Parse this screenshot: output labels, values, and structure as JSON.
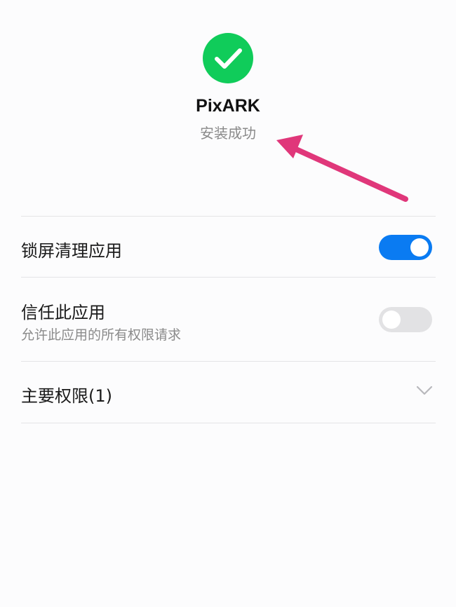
{
  "app": {
    "name": "PixARK",
    "status": "安装成功"
  },
  "settings": [
    {
      "label": "锁屏清理应用",
      "enabled": true
    },
    {
      "label": "信任此应用",
      "sublabel": "允许此应用的所有权限请求",
      "enabled": false
    }
  ],
  "permissions": {
    "label": "主要权限(1)"
  },
  "colors": {
    "success": "#10cc5a",
    "toggle_on": "#0a7bf2",
    "annotation_arrow": "#e0377a"
  }
}
